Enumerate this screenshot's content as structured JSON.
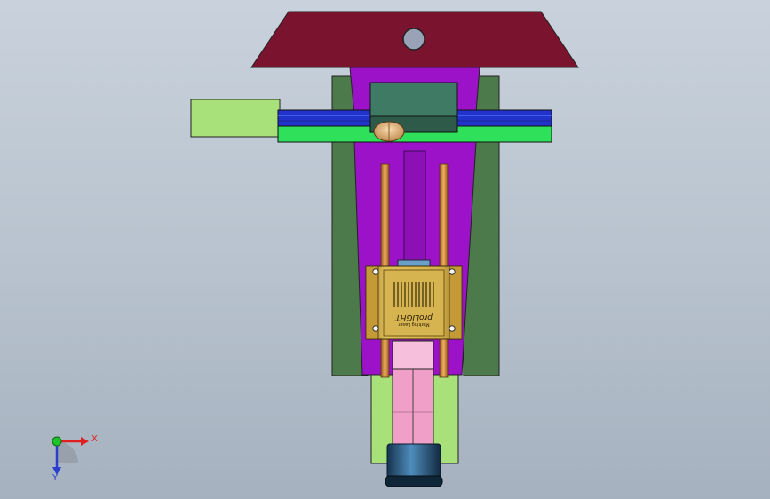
{
  "viewport": {
    "background_top": "#c9d2dc",
    "background_bottom": "#a6b1bf"
  },
  "model": {
    "part_colors": {
      "top_cap": "#7a142e",
      "body_side": "#4d7a4a",
      "body_center": "#9b12c8",
      "guide_rail": "#2233cc",
      "rail_base": "#2ee05a",
      "side_block": "#a8e07a",
      "center_block": "#3e7a64",
      "rods": "#d08a3a",
      "laser_housing": "#c9a23a",
      "lower_tube": "#f0a0c8",
      "nozzle": "#2d5f8a"
    },
    "label_plate": {
      "brand": "proLIGHT",
      "subtitle": "Marking Laser"
    }
  },
  "triad": {
    "x_label": "X",
    "y_label": "Y",
    "x_color": "#e02020",
    "y_color": "#2a3fd0",
    "origin_color": "#1cc32a"
  }
}
